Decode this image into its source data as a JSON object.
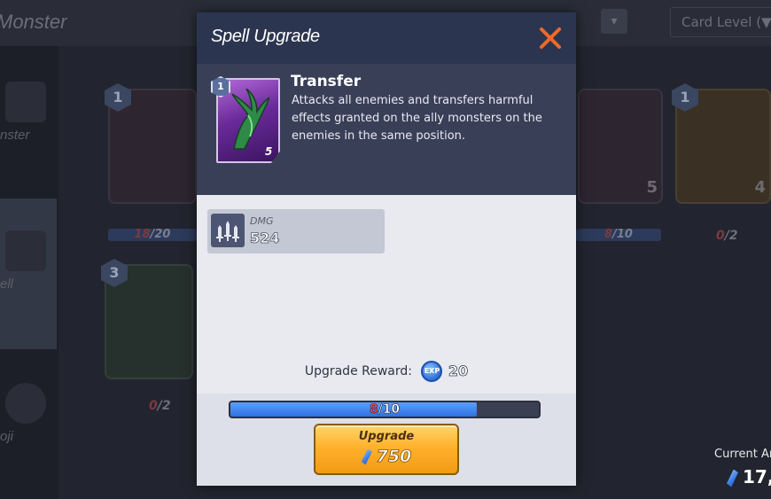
{
  "background": {
    "title": "Monster",
    "sort_label": "Card Level (▼",
    "sidebar": [
      {
        "label": "nster"
      },
      {
        "label": "ell"
      },
      {
        "label": "oji"
      }
    ],
    "cards": [
      {
        "level": "1",
        "cost": "",
        "count_cur": "18",
        "count_max": "/20"
      },
      {
        "level": "3",
        "cost": "",
        "count_cur": "0",
        "count_max": "/2"
      },
      {
        "level": "",
        "cost": "5",
        "count_cur": "8",
        "count_max": "/10"
      },
      {
        "level": "1",
        "cost": "4",
        "count_cur": "0",
        "count_max": "/2"
      }
    ],
    "currency_label": "Current Ar",
    "currency_value": "17,"
  },
  "modal": {
    "title": "Spell Upgrade",
    "close_icon": "close-icon",
    "spell": {
      "level": "1",
      "cost": "5",
      "name": "Transfer",
      "description": "Attacks all enemies and transfers harmful effects granted on the ally monsters on the enemies in the same position."
    },
    "stat": {
      "icon": "swords-icon",
      "label": "DMG",
      "value": "524"
    },
    "reward": {
      "label": "Upgrade Reward:",
      "icon": "exp-icon",
      "icon_text": "EXP",
      "value": "20"
    },
    "progress": {
      "current": "8",
      "max": "/10",
      "fraction": 0.8
    },
    "upgrade_button": {
      "label": "Upgrade",
      "cost": "750"
    }
  },
  "colors": {
    "header": "#2c3550",
    "progress_fill": "#2f6fe0",
    "button": "#ffb22c",
    "close": "#f06a2a"
  }
}
